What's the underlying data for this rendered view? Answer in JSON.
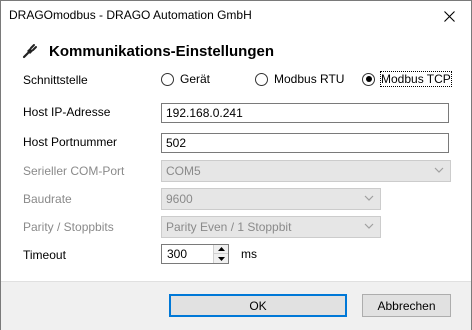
{
  "window": {
    "title": "DRAGOmodbus - DRAGO Automation GmbH"
  },
  "heading": {
    "text": "Kommunikations-Einstellungen"
  },
  "interface": {
    "label": "Schnittstelle",
    "options": [
      {
        "label": "Gerät",
        "checked": false
      },
      {
        "label": "Modbus RTU",
        "checked": false
      },
      {
        "label": "Modbus TCP",
        "checked": true
      }
    ]
  },
  "host_ip": {
    "label": "Host IP-Adresse",
    "value": "192.168.0.241"
  },
  "host_port": {
    "label": "Host Portnummer",
    "value": "502"
  },
  "com_port": {
    "label": "Serieller COM-Port",
    "value": "COM5"
  },
  "baudrate": {
    "label": "Baudrate",
    "value": "9600"
  },
  "parity": {
    "label": "Parity / Stoppbits",
    "value": "Parity Even / 1 Stoppbit"
  },
  "timeout": {
    "label": "Timeout",
    "value": "300",
    "unit": "ms"
  },
  "buttons": {
    "ok": "OK",
    "cancel": "Abbrechen"
  },
  "icons": {
    "close": "close-icon",
    "heading": "plug-icon"
  }
}
